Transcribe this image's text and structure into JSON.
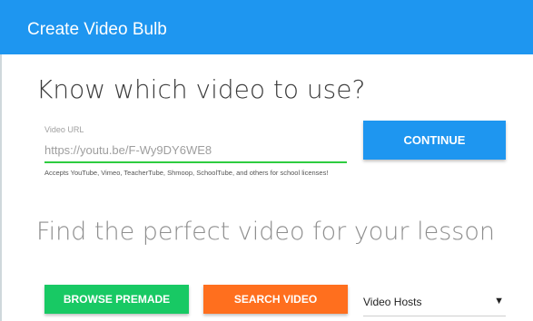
{
  "header": {
    "title": "Create Video Bulb"
  },
  "url_section": {
    "title": "Know which video to use?",
    "label": "Video URL",
    "placeholder": "https://youtu.be/F-Wy9DY6WE8",
    "helper": "Accepts YouTube, Vimeo, TeacherTube, Shmoop, SchoolTube, and others for school licenses!",
    "continue_label": "CONTINUE"
  },
  "find_section": {
    "title": "Find the perfect video for your lesson",
    "browse_label": "BROWSE PREMADE",
    "search_label": "SEARCH VIDEO",
    "hosts_select": {
      "value": "Video Hosts",
      "arrow_icon": "caret-down-icon"
    }
  },
  "colors": {
    "header": "#1e96f0",
    "continue": "#1e96f0",
    "browse": "#18c964",
    "search": "#ff6f1e",
    "input_underline": "#2ecc40"
  }
}
